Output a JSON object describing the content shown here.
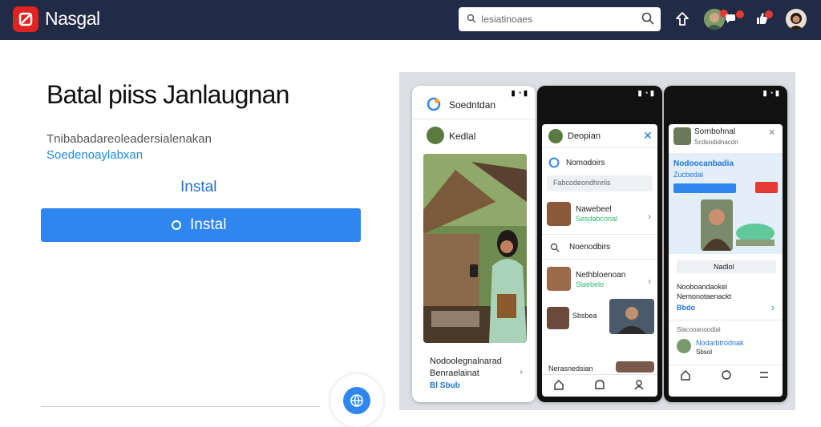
{
  "header": {
    "brand": "Nasgal",
    "search_placeholder": "Iesiatinoaes"
  },
  "hero": {
    "headline": "Batal piiss Janlaugnan",
    "desc_line1": "Tnibabadareoleadersialenakan",
    "desc_line2": "Soedenoaylabxan",
    "install_link": "Instal",
    "install_button": "Instal"
  },
  "phone1": {
    "title": "Soedntdan",
    "profile": "Kedlal",
    "caption1": "Nodoolegnalnarad",
    "caption2": "Benraelainat",
    "tag": "Bl Sbub"
  },
  "phone2": {
    "title": "Deopian",
    "section": "Nomodoirs",
    "search": "Fabcodeondhnrlis",
    "item1_title": "Nawebeel",
    "item1_sub": "Sesdabcnnal",
    "section2": "Noenodbirs",
    "item2_title": "Nethbloenoan",
    "item2_sub": "Slaebelo",
    "item3_title": "Sbsbea",
    "item4_title": "Nerasnedsian"
  },
  "phone3": {
    "title": "Sornbohnal",
    "subtitle": "Scdsodidnacdn",
    "card_title": "Nodoocanbadia",
    "card_sub": "Zucbedal",
    "button": "Nadlol",
    "body1": "Nooboandaokel",
    "body2": "Nemonotaenackt",
    "tag": "Bbdo",
    "small": "Slacooanoodlal",
    "footer_title": "Nodarbtrodnak",
    "footer_sub": "Sbsol"
  },
  "colors": {
    "topbar": "#222b45",
    "accent": "#2f86ee",
    "logo": "#e02424"
  }
}
